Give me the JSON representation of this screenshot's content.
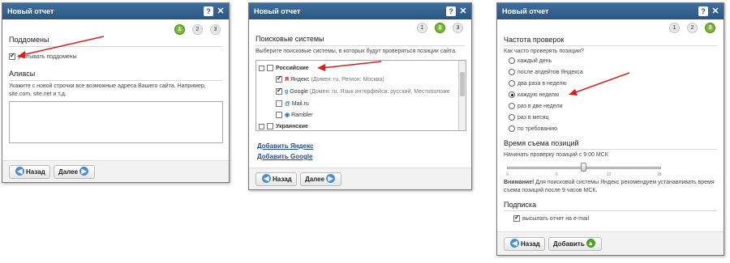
{
  "colors": {
    "titlebar": "#2a557f",
    "active_step": "#5a9e1e",
    "annotation_arrow": "#d42020",
    "link": "#1f4f8f"
  },
  "dialog1": {
    "title": "Новый отчет",
    "steps": [
      "1",
      "2",
      "3"
    ],
    "active_step": "1",
    "subdomains_title": "Поддомены",
    "subdomains_checkbox": "учитывать поддомены",
    "aliases_title": "Алиасы",
    "aliases_help_line1": "Укажите с новой строчки все возможные адреса Вашего сайта. Например,",
    "aliases_help_line2": "site.com, site.net и т.д.",
    "aliases_value": "",
    "back_label": "Назад",
    "next_label": "Далее"
  },
  "dialog2": {
    "title": "Новый отчет",
    "steps": [
      "1",
      "2",
      "3"
    ],
    "active_step": "2",
    "section_title": "Поисковые системы",
    "help": "Выберите поисковые системы, в которых будут проверяться позиции сайта.",
    "group_russian": "Российские",
    "engines": [
      {
        "name": "Яндекс",
        "meta": "(Домен: ru, Регион: Москва)",
        "checked": true,
        "icon": "yandex-icon"
      },
      {
        "name": "Google",
        "meta": "(Домен: ru, Язык интерфейса: русский, Местоположе",
        "checked": true,
        "icon": "google-icon"
      },
      {
        "name": "Mail.ru",
        "meta": "",
        "checked": false,
        "icon": "mailru-icon"
      },
      {
        "name": "Rambler",
        "meta": "",
        "checked": false,
        "icon": "rambler-icon"
      }
    ],
    "group_ukrainian": "Украинские",
    "add_yandex": "Добавить Яндекс",
    "add_google": "Добавить Google",
    "back_label": "Назад",
    "next_label": "Далее"
  },
  "dialog3": {
    "title": "Новый отчет",
    "steps": [
      "1",
      "2",
      "3"
    ],
    "active_step": "3",
    "freq_title": "Частота проверок",
    "freq_question": "Как часто проверять позиции?",
    "freq_options": [
      "каждый день",
      "после апдейтов Яндекса",
      "два раза в неделю",
      "каждую неделю",
      "раз в две недели",
      "раз в месяц",
      "по требованию"
    ],
    "freq_selected": "каждую неделю",
    "time_title": "Время съема позиций",
    "time_text": "Начинать проверку позиций с 9:00 МСК",
    "slider_ticks": [
      "0",
      "6",
      "12",
      "18"
    ],
    "slider_value": 9,
    "warning_label": "Внимание!",
    "warning_text_line1": " Для поисковой системы Яндекс рекомендуем устанавливать время",
    "warning_text_line2": "съема позиций после 9 часов МСК.",
    "subscription_title": "Подписка",
    "subscription_checkbox": "высылать отчет на e-mail",
    "back_label": "Назад",
    "add_label": "Добавить"
  }
}
